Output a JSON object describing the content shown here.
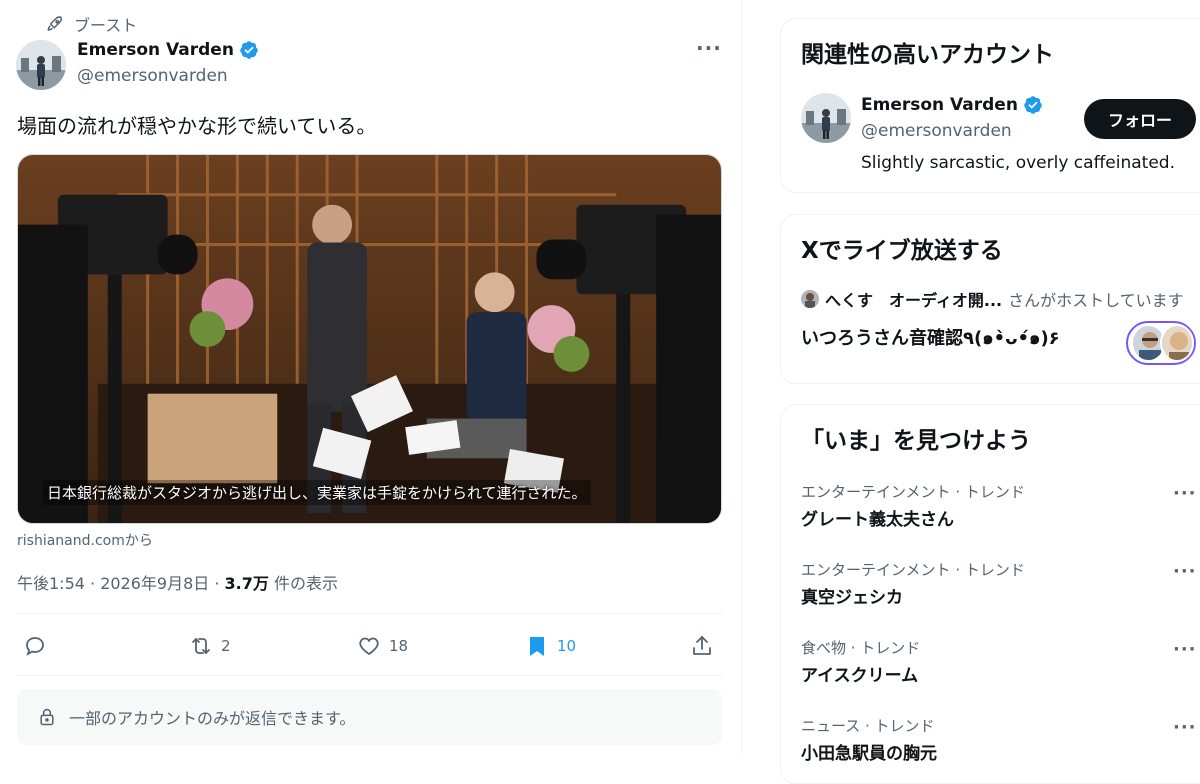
{
  "tweet": {
    "boost_label": "ブースト",
    "author_name": "Emerson Varden",
    "author_handle": "@emersonvarden",
    "text": "場面の流れが穏やかな形で続いている。",
    "media_caption": "日本銀行総裁がスタジオから逃げ出し、実業家は手錠をかけられて連行された。",
    "source": "rishianand.comから",
    "time": "午後1:54 · 2026年9月8日 · ",
    "views_count": "3.7万",
    "views_label": " 件の表示",
    "actions": {
      "reply_count": "",
      "repost_count": "2",
      "like_count": "18",
      "bookmark_count": "10"
    },
    "reply_restriction": "一部のアカウントのみが返信できます。",
    "more_icon": "more-icon"
  },
  "sidebar": {
    "related": {
      "title": "関連性の高いアカウント",
      "name": "Emerson Varden",
      "handle": "@emersonvarden",
      "bio": "Slightly sarcastic, overly caffeinated.",
      "follow_label": "フォロー"
    },
    "live": {
      "title": "Xでライブ放送する",
      "host_name": "へくす　オーディオ開...",
      "host_suffix": "さんがホストしています",
      "space_title": "いつろうさん音確認٩(๑•̀ᴗ•́๑)۶"
    },
    "trends": {
      "title": "「いま」を見つけよう",
      "items": [
        {
          "category": "エンターテインメント · トレンド",
          "name": "グレート義太夫さん"
        },
        {
          "category": "エンターテインメント · トレンド",
          "name": "真空ジェシカ"
        },
        {
          "category": "食べ物 · トレンド",
          "name": "アイスクリーム"
        },
        {
          "category": "ニュース · トレンド",
          "name": "小田急駅員の胸元"
        }
      ]
    }
  },
  "colors": {
    "accent": "#1d9bf0",
    "text": "#0f1419",
    "muted": "#536471",
    "live_ring": "#7856ff"
  }
}
